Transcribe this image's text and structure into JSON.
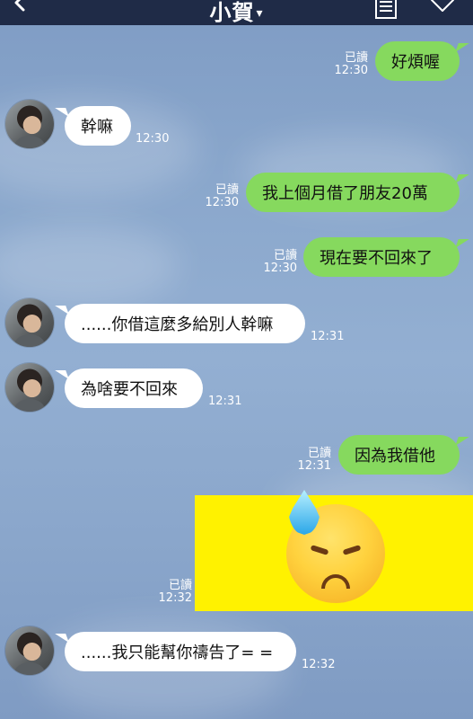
{
  "header": {
    "title": "小賀",
    "title_caret": "▾"
  },
  "status": {
    "read_label": "已讀"
  },
  "messages": [
    {
      "text": "好煩喔",
      "time": "12:30"
    },
    {
      "text": "幹嘛",
      "time": "12:30"
    },
    {
      "text": "我上個月借了朋友20萬",
      "time": "12:30"
    },
    {
      "text": "現在要不回來了",
      "time": "12:30"
    },
    {
      "text": "......你借這麼多給別人幹嘛",
      "time": "12:31"
    },
    {
      "text": "為啥要不回來",
      "time": "12:31"
    },
    {
      "text": "因為我借他",
      "time": "12:31"
    },
    {
      "text": "",
      "time": "12:32"
    },
    {
      "text": "......我只能幫你禱告了= =",
      "time": "12:32"
    }
  ],
  "colors": {
    "header_bg": "#1f2b47",
    "bubble_self": "#86d95e",
    "bubble_other": "#ffffff",
    "sticker_bg": "#fff200"
  },
  "icons": {
    "back": "back-arrow-icon",
    "notes": "notes-icon",
    "more": "chevron-down-icon",
    "sticker": "sweat-face-emoji-icon"
  }
}
